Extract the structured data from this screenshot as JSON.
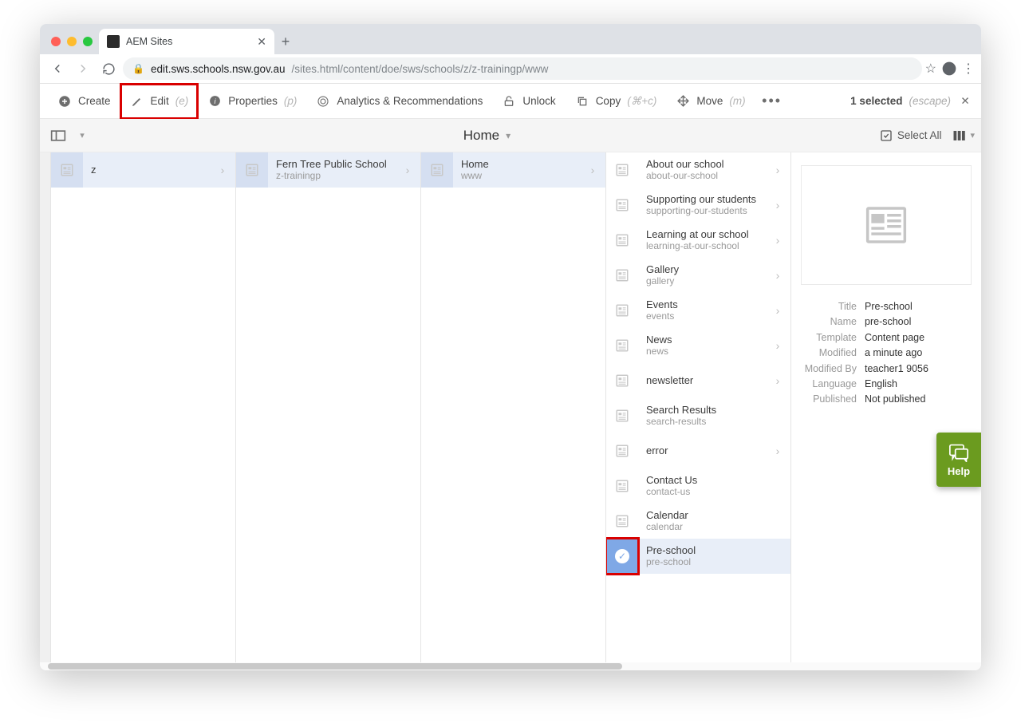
{
  "browser": {
    "tab_title": "AEM Sites",
    "url_host": "edit.sws.schools.nsw.gov.au",
    "url_path": "/sites.html/content/doe/sws/schools/z/z-trainingp/www"
  },
  "actions": {
    "create": "Create",
    "edit": "Edit",
    "edit_hint": "(e)",
    "properties": "Properties",
    "properties_hint": "(p)",
    "analytics": "Analytics & Recommendations",
    "unlock": "Unlock",
    "copy": "Copy",
    "copy_hint": "(⌘+c)",
    "move": "Move",
    "move_hint": "(m)",
    "selected_count": "1 selected",
    "selected_hint": "(escape)"
  },
  "rail": {
    "breadcrumb_title": "Home",
    "select_all": "Select All"
  },
  "columns": [
    {
      "items": [
        {
          "title": "z",
          "name": "",
          "has_children": true,
          "selected_path": true
        }
      ]
    },
    {
      "items": [
        {
          "title": "Fern Tree Public School",
          "name": "z-trainingp",
          "has_children": true,
          "selected_path": true
        }
      ]
    },
    {
      "items": [
        {
          "title": "Home",
          "name": "www",
          "has_children": true,
          "selected_path": true
        }
      ]
    },
    {
      "items": [
        {
          "title": "About our school",
          "name": "about-our-school",
          "has_children": true
        },
        {
          "title": "Supporting our students",
          "name": "supporting-our-students",
          "has_children": true
        },
        {
          "title": "Learning at our school",
          "name": "learning-at-our-school",
          "has_children": true
        },
        {
          "title": "Gallery",
          "name": "gallery",
          "has_children": true
        },
        {
          "title": "Events",
          "name": "events",
          "has_children": true
        },
        {
          "title": "News",
          "name": "news",
          "has_children": true
        },
        {
          "title": "newsletter",
          "name": "",
          "has_children": true
        },
        {
          "title": "Search Results",
          "name": "search-results",
          "has_children": false
        },
        {
          "title": "error",
          "name": "",
          "has_children": true
        },
        {
          "title": "Contact Us",
          "name": "contact-us",
          "has_children": false
        },
        {
          "title": "Calendar",
          "name": "calendar",
          "has_children": false
        },
        {
          "title": "Pre-school",
          "name": "pre-school",
          "has_children": false,
          "selected": true
        }
      ]
    }
  ],
  "detail": {
    "meta": [
      {
        "k": "Title",
        "v": "Pre-school"
      },
      {
        "k": "Name",
        "v": "pre-school"
      },
      {
        "k": "Template",
        "v": "Content page"
      },
      {
        "k": "Modified",
        "v": "a minute ago"
      },
      {
        "k": "Modified By",
        "v": "teacher1 9056"
      },
      {
        "k": "Language",
        "v": "English"
      },
      {
        "k": "Published",
        "v": "Not published"
      }
    ]
  },
  "help_label": "Help"
}
